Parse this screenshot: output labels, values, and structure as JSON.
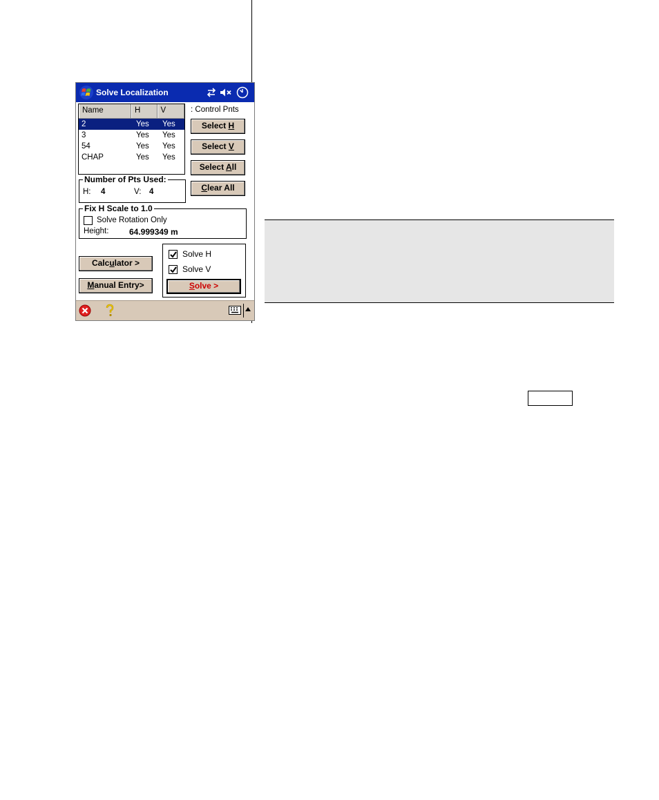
{
  "window": {
    "title": "Solve Localization"
  },
  "list": {
    "columns": [
      "Name",
      "H",
      "V"
    ],
    "rows": [
      {
        "name": "2",
        "h": "Yes",
        "v": "Yes",
        "selected": true
      },
      {
        "name": "3",
        "h": "Yes",
        "v": "Yes",
        "selected": false
      },
      {
        "name": "54",
        "h": "Yes",
        "v": "Yes",
        "selected": false
      },
      {
        "name": "CHAP",
        "h": "Yes",
        "v": "Yes",
        "selected": false
      }
    ]
  },
  "control_pnts_label": ": Control Pnts",
  "buttons": {
    "select_h": {
      "pre": "Select ",
      "ul": "H",
      "post": ""
    },
    "select_v": {
      "pre": "Select ",
      "ul": "V",
      "post": ""
    },
    "select_all": {
      "pre": "Select ",
      "ul": "A",
      "post": "ll"
    },
    "clear_all": {
      "pre": "",
      "ul": "C",
      "post": "lear All"
    },
    "calculator": {
      "pre": "Calc",
      "ul": "u",
      "post": "lator >"
    },
    "manual_entry": {
      "pre": "",
      "ul": "M",
      "post": "anual Entry>"
    },
    "solve": {
      "pre": "",
      "ul": "S",
      "post": "olve >"
    }
  },
  "pts_used": {
    "title": "Number of Pts Used:",
    "h_label": "H:",
    "h_value": "4",
    "v_label": "V:",
    "v_value": "4"
  },
  "fix_scale": {
    "title": "Fix H Scale to 1.0",
    "solve_rotation_label": "Solve Rotation Only",
    "solve_rotation_checked": false,
    "height_label": "Height:",
    "height_value": "64.999349 m"
  },
  "solve_options": {
    "solve_h_label": "Solve H",
    "solve_h_checked": true,
    "solve_v_label": "Solve V",
    "solve_v_checked": true
  },
  "colors": {
    "titlebar": "#0a2bb0",
    "selection": "#0a2080",
    "button_face": "#d8c9b8",
    "solve_text": "#cc0000"
  },
  "icons": [
    "windows-start-icon",
    "connectivity-icon",
    "speaker-muted-icon",
    "clock-icon",
    "close-icon",
    "help-icon",
    "keyboard-icon",
    "up-arrow-icon"
  ]
}
